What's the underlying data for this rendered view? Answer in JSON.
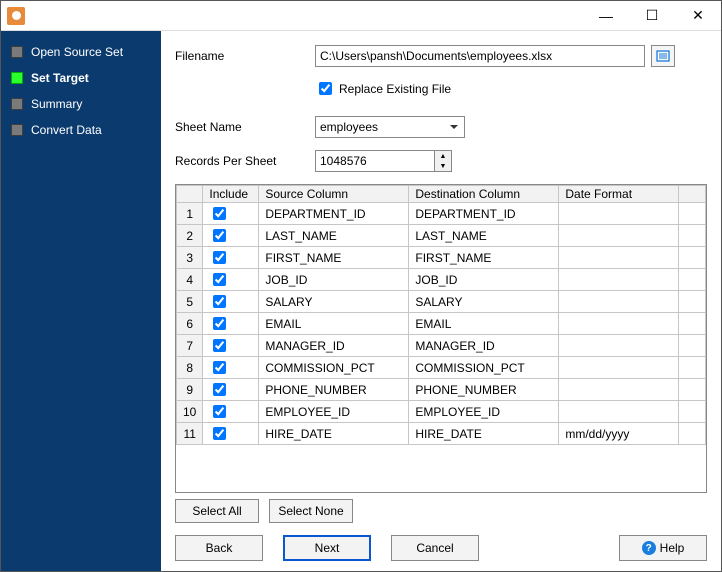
{
  "window_controls": {
    "min": "—",
    "max": "☐",
    "close": "✕"
  },
  "sidebar": {
    "steps": [
      {
        "label": "Open Source Set",
        "current": false
      },
      {
        "label": "Set Target",
        "current": true
      },
      {
        "label": "Summary",
        "current": false
      },
      {
        "label": "Convert Data",
        "current": false
      }
    ]
  },
  "form": {
    "filename_label": "Filename",
    "filename_value": "C:\\Users\\pansh\\Documents\\employees.xlsx",
    "replace_label": "Replace Existing File",
    "replace_checked": true,
    "sheet_label": "Sheet Name",
    "sheet_value": "employees",
    "records_label": "Records Per Sheet",
    "records_value": "1048576"
  },
  "grid": {
    "headers": {
      "rownum": "",
      "include": "Include",
      "source": "Source Column",
      "dest": "Destination Column",
      "fmt": "Date Format"
    },
    "rows": [
      {
        "n": "1",
        "inc": true,
        "src": "DEPARTMENT_ID",
        "dst": "DEPARTMENT_ID",
        "fmt": ""
      },
      {
        "n": "2",
        "inc": true,
        "src": "LAST_NAME",
        "dst": "LAST_NAME",
        "fmt": ""
      },
      {
        "n": "3",
        "inc": true,
        "src": "FIRST_NAME",
        "dst": "FIRST_NAME",
        "fmt": ""
      },
      {
        "n": "4",
        "inc": true,
        "src": "JOB_ID",
        "dst": "JOB_ID",
        "fmt": ""
      },
      {
        "n": "5",
        "inc": true,
        "src": "SALARY",
        "dst": "SALARY",
        "fmt": ""
      },
      {
        "n": "6",
        "inc": true,
        "src": "EMAIL",
        "dst": "EMAIL",
        "fmt": ""
      },
      {
        "n": "7",
        "inc": true,
        "src": "MANAGER_ID",
        "dst": "MANAGER_ID",
        "fmt": ""
      },
      {
        "n": "8",
        "inc": true,
        "src": "COMMISSION_PCT",
        "dst": "COMMISSION_PCT",
        "fmt": ""
      },
      {
        "n": "9",
        "inc": true,
        "src": "PHONE_NUMBER",
        "dst": "PHONE_NUMBER",
        "fmt": ""
      },
      {
        "n": "10",
        "inc": true,
        "src": "EMPLOYEE_ID",
        "dst": "EMPLOYEE_ID",
        "fmt": ""
      },
      {
        "n": "11",
        "inc": true,
        "src": "HIRE_DATE",
        "dst": "HIRE_DATE",
        "fmt": "mm/dd/yyyy"
      }
    ]
  },
  "buttons": {
    "select_all": "Select All",
    "select_none": "Select None",
    "back": "Back",
    "next": "Next",
    "cancel": "Cancel",
    "help": "Help"
  }
}
